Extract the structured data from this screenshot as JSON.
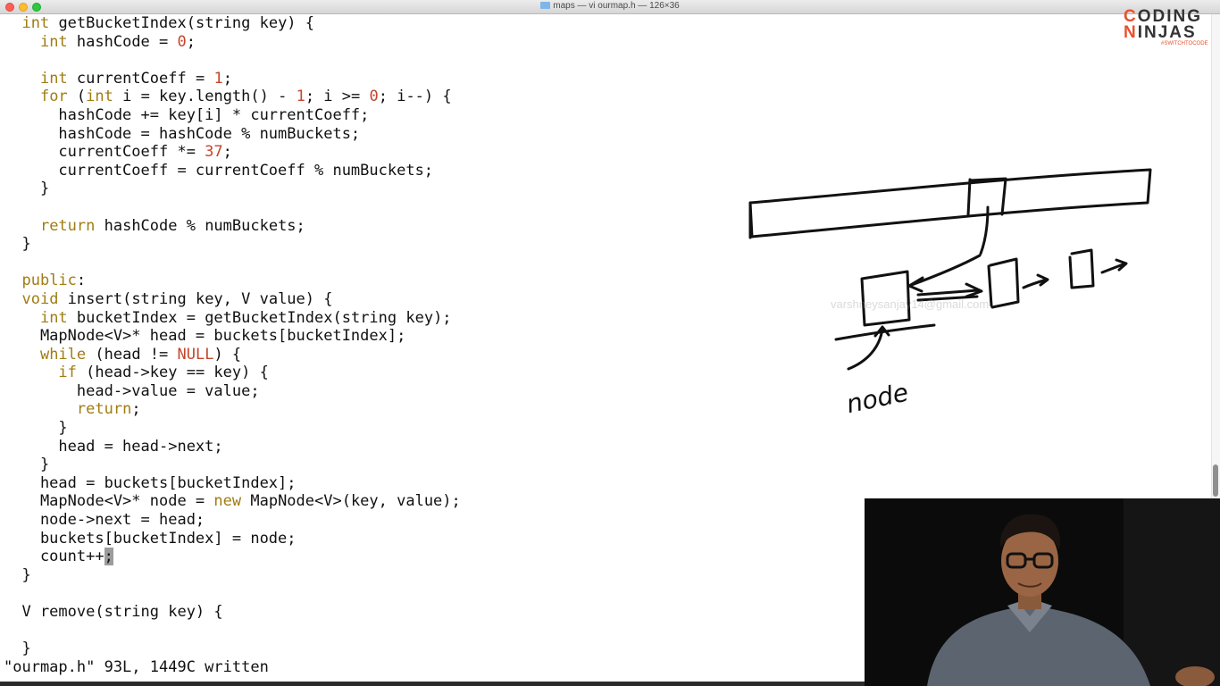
{
  "window": {
    "title": "maps — vi ourmap.h — 126×36"
  },
  "logo": {
    "line1_c": "C",
    "line1_rest": "ODING",
    "line2_c": "N",
    "line2_rest": "INJAS",
    "tagline": "#SWITCHTOCODE"
  },
  "editor": {
    "status_line": "\"ourmap.h\" 93L, 1449C written",
    "lines": [
      [
        {
          "t": "  "
        },
        {
          "t": "int",
          "c": "k"
        },
        {
          "t": " getBucketIndex(string key) {"
        }
      ],
      [
        {
          "t": "    "
        },
        {
          "t": "int",
          "c": "k"
        },
        {
          "t": " hashCode = "
        },
        {
          "t": "0",
          "c": "n"
        },
        {
          "t": ";"
        }
      ],
      [
        {
          "t": ""
        }
      ],
      [
        {
          "t": "    "
        },
        {
          "t": "int",
          "c": "k"
        },
        {
          "t": " currentCoeff = "
        },
        {
          "t": "1",
          "c": "n"
        },
        {
          "t": ";"
        }
      ],
      [
        {
          "t": "    "
        },
        {
          "t": "for",
          "c": "k"
        },
        {
          "t": " ("
        },
        {
          "t": "int",
          "c": "k"
        },
        {
          "t": " i = key.length() - "
        },
        {
          "t": "1",
          "c": "n"
        },
        {
          "t": "; i >= "
        },
        {
          "t": "0",
          "c": "n"
        },
        {
          "t": "; i--) {"
        }
      ],
      [
        {
          "t": "      hashCode += key[i] * currentCoeff;"
        }
      ],
      [
        {
          "t": "      hashCode = hashCode % numBuckets;"
        }
      ],
      [
        {
          "t": "      currentCoeff *= "
        },
        {
          "t": "37",
          "c": "n"
        },
        {
          "t": ";"
        }
      ],
      [
        {
          "t": "      currentCoeff = currentCoeff % numBuckets;"
        }
      ],
      [
        {
          "t": "    }"
        }
      ],
      [
        {
          "t": ""
        }
      ],
      [
        {
          "t": "    "
        },
        {
          "t": "return",
          "c": "k"
        },
        {
          "t": " hashCode % numBuckets;"
        }
      ],
      [
        {
          "t": "  }"
        }
      ],
      [
        {
          "t": ""
        }
      ],
      [
        {
          "t": "  "
        },
        {
          "t": "public",
          "c": "k"
        },
        {
          "t": ":"
        }
      ],
      [
        {
          "t": "  "
        },
        {
          "t": "void",
          "c": "k"
        },
        {
          "t": " insert(string key, V value) {"
        }
      ],
      [
        {
          "t": "    "
        },
        {
          "t": "int",
          "c": "k"
        },
        {
          "t": " bucketIndex = getBucketIndex(string key);"
        }
      ],
      [
        {
          "t": "    MapNode<V>* head = buckets[bucketIndex];"
        }
      ],
      [
        {
          "t": "    "
        },
        {
          "t": "while",
          "c": "k"
        },
        {
          "t": " (head != "
        },
        {
          "t": "NULL",
          "c": "n"
        },
        {
          "t": ") {"
        }
      ],
      [
        {
          "t": "      "
        },
        {
          "t": "if",
          "c": "k"
        },
        {
          "t": " (head->key == key) {"
        }
      ],
      [
        {
          "t": "        head->value = value;"
        }
      ],
      [
        {
          "t": "        "
        },
        {
          "t": "return",
          "c": "k"
        },
        {
          "t": ";"
        }
      ],
      [
        {
          "t": "      }"
        }
      ],
      [
        {
          "t": "      head = head->next;"
        }
      ],
      [
        {
          "t": "    }"
        }
      ],
      [
        {
          "t": "    head = buckets[bucketIndex];"
        }
      ],
      [
        {
          "t": "    MapNode<V>* node = "
        },
        {
          "t": "new",
          "c": "k"
        },
        {
          "t": " MapNode<V>(key, value);"
        }
      ],
      [
        {
          "t": "    node->next = head;"
        }
      ],
      [
        {
          "t": "    buckets[bucketIndex] = node;"
        }
      ],
      [
        {
          "t": "    count++"
        },
        {
          "t": ";",
          "c": "cursor"
        }
      ],
      [
        {
          "t": "  }"
        }
      ],
      [
        {
          "t": ""
        }
      ],
      [
        {
          "t": "  V remove(string key) {"
        }
      ],
      [
        {
          "t": ""
        }
      ],
      [
        {
          "t": "  }"
        }
      ]
    ]
  },
  "whiteboard": {
    "handwritten_label": "node",
    "watermark": "varshneysanjay14@gmail.com"
  },
  "webcam": {
    "description_label": "presenter"
  }
}
